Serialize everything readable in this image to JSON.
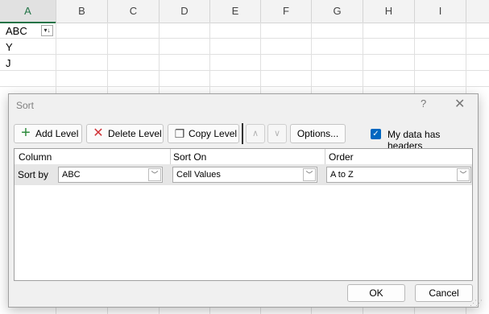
{
  "sheet": {
    "columns": [
      "A",
      "B",
      "C",
      "D",
      "E",
      "F",
      "G",
      "H",
      "I"
    ],
    "cells": {
      "A1": "ABC",
      "A2": "Y",
      "A3": "J"
    },
    "filter_icon": "filter-sort-icon"
  },
  "dialog": {
    "title": "Sort",
    "help": "?",
    "close": "✕",
    "toolbar": {
      "add_level": "Add Level",
      "delete_level": "Delete Level",
      "copy_level": "Copy Level",
      "move_up": "∧",
      "move_down": "∨",
      "options": "Options..."
    },
    "headers_checkbox": {
      "label": "My data has headers",
      "checked": true
    },
    "table": {
      "headers": {
        "column": "Column",
        "sort_on": "Sort On",
        "order": "Order"
      },
      "rows": [
        {
          "label": "Sort by",
          "column": "ABC",
          "sort_on": "Cell Values",
          "order": "A to Z"
        }
      ]
    },
    "ok": "OK",
    "cancel": "Cancel"
  },
  "colors": {
    "accent": "#0067c0",
    "excel_green": "#217346",
    "add_icon": "#2e8b3d",
    "delete_icon": "#d13438"
  }
}
